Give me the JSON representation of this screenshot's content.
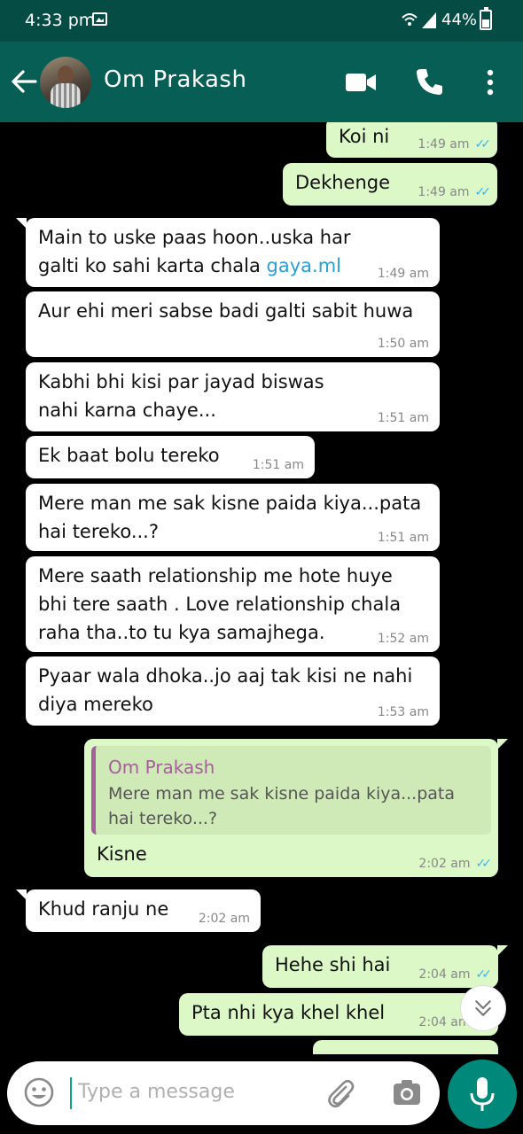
{
  "status_bar": {
    "time": "4:33 pm",
    "battery": "44%"
  },
  "header": {
    "contact_name": "Om Prakash"
  },
  "messages": [
    {
      "direction": "out",
      "text": "Koi ni",
      "time": "1:49 am",
      "read": true
    },
    {
      "direction": "out",
      "text": "Dekhenge",
      "time": "1:49 am",
      "read": true
    },
    {
      "direction": "in",
      "text": "Main to uske paas hoon..uska har galti ko sahi karta chala ",
      "link": "gaya.ml",
      "time": "1:49 am"
    },
    {
      "direction": "in",
      "text": "Aur ehi meri sabse badi galti sabit huwa",
      "time": "1:50 am"
    },
    {
      "direction": "in",
      "text": "Kabhi bhi kisi par jayad biswas nahi karna chaye...",
      "time": "1:51 am"
    },
    {
      "direction": "in",
      "text": "Ek baat bolu tereko",
      "time": "1:51 am"
    },
    {
      "direction": "in",
      "text": "Mere man me sak kisne paida kiya...pata hai tereko...?",
      "time": "1:51 am"
    },
    {
      "direction": "in",
      "text": "Mere saath relationship me hote huye bhi tere saath . Love relationship chala raha tha..to tu kya samajhega.",
      "time": "1:52 am"
    },
    {
      "direction": "in",
      "text": "Pyaar wala dhoka..jo aaj tak kisi ne nahi diya mereko",
      "time": "1:53 am"
    },
    {
      "direction": "out",
      "quote_name": "Om Prakash",
      "quote_text": "Mere man me sak kisne paida kiya...pata hai tereko...?",
      "text": "Kisne",
      "time": "2:02 am",
      "read": true
    },
    {
      "direction": "in",
      "text": "Khud ranju ne",
      "time": "2:02 am"
    },
    {
      "direction": "out",
      "text": "Hehe shi hai",
      "time": "2:04 am",
      "read": true
    },
    {
      "direction": "out",
      "text": "Pta nhi kya khel khel",
      "time": "2:04 am",
      "read": true
    }
  ],
  "input": {
    "placeholder": "Type a message"
  },
  "icons": {
    "back": "arrow-left-icon",
    "video": "video-call-icon",
    "call": "phone-icon",
    "menu": "more-vert-icon",
    "emoji": "emoji-icon",
    "attach": "paperclip-icon",
    "camera": "camera-icon",
    "mic": "mic-icon",
    "scroll": "chevron-double-down-icon",
    "read": "double-check-icon"
  },
  "colors": {
    "header": "#075e54",
    "status_bar": "#054c44",
    "outgoing": "#dcf8c6",
    "incoming": "#ffffff",
    "read_ticks": "#34b7f1",
    "mic_button": "#00897b",
    "quote_accent": "#a55f9b"
  }
}
